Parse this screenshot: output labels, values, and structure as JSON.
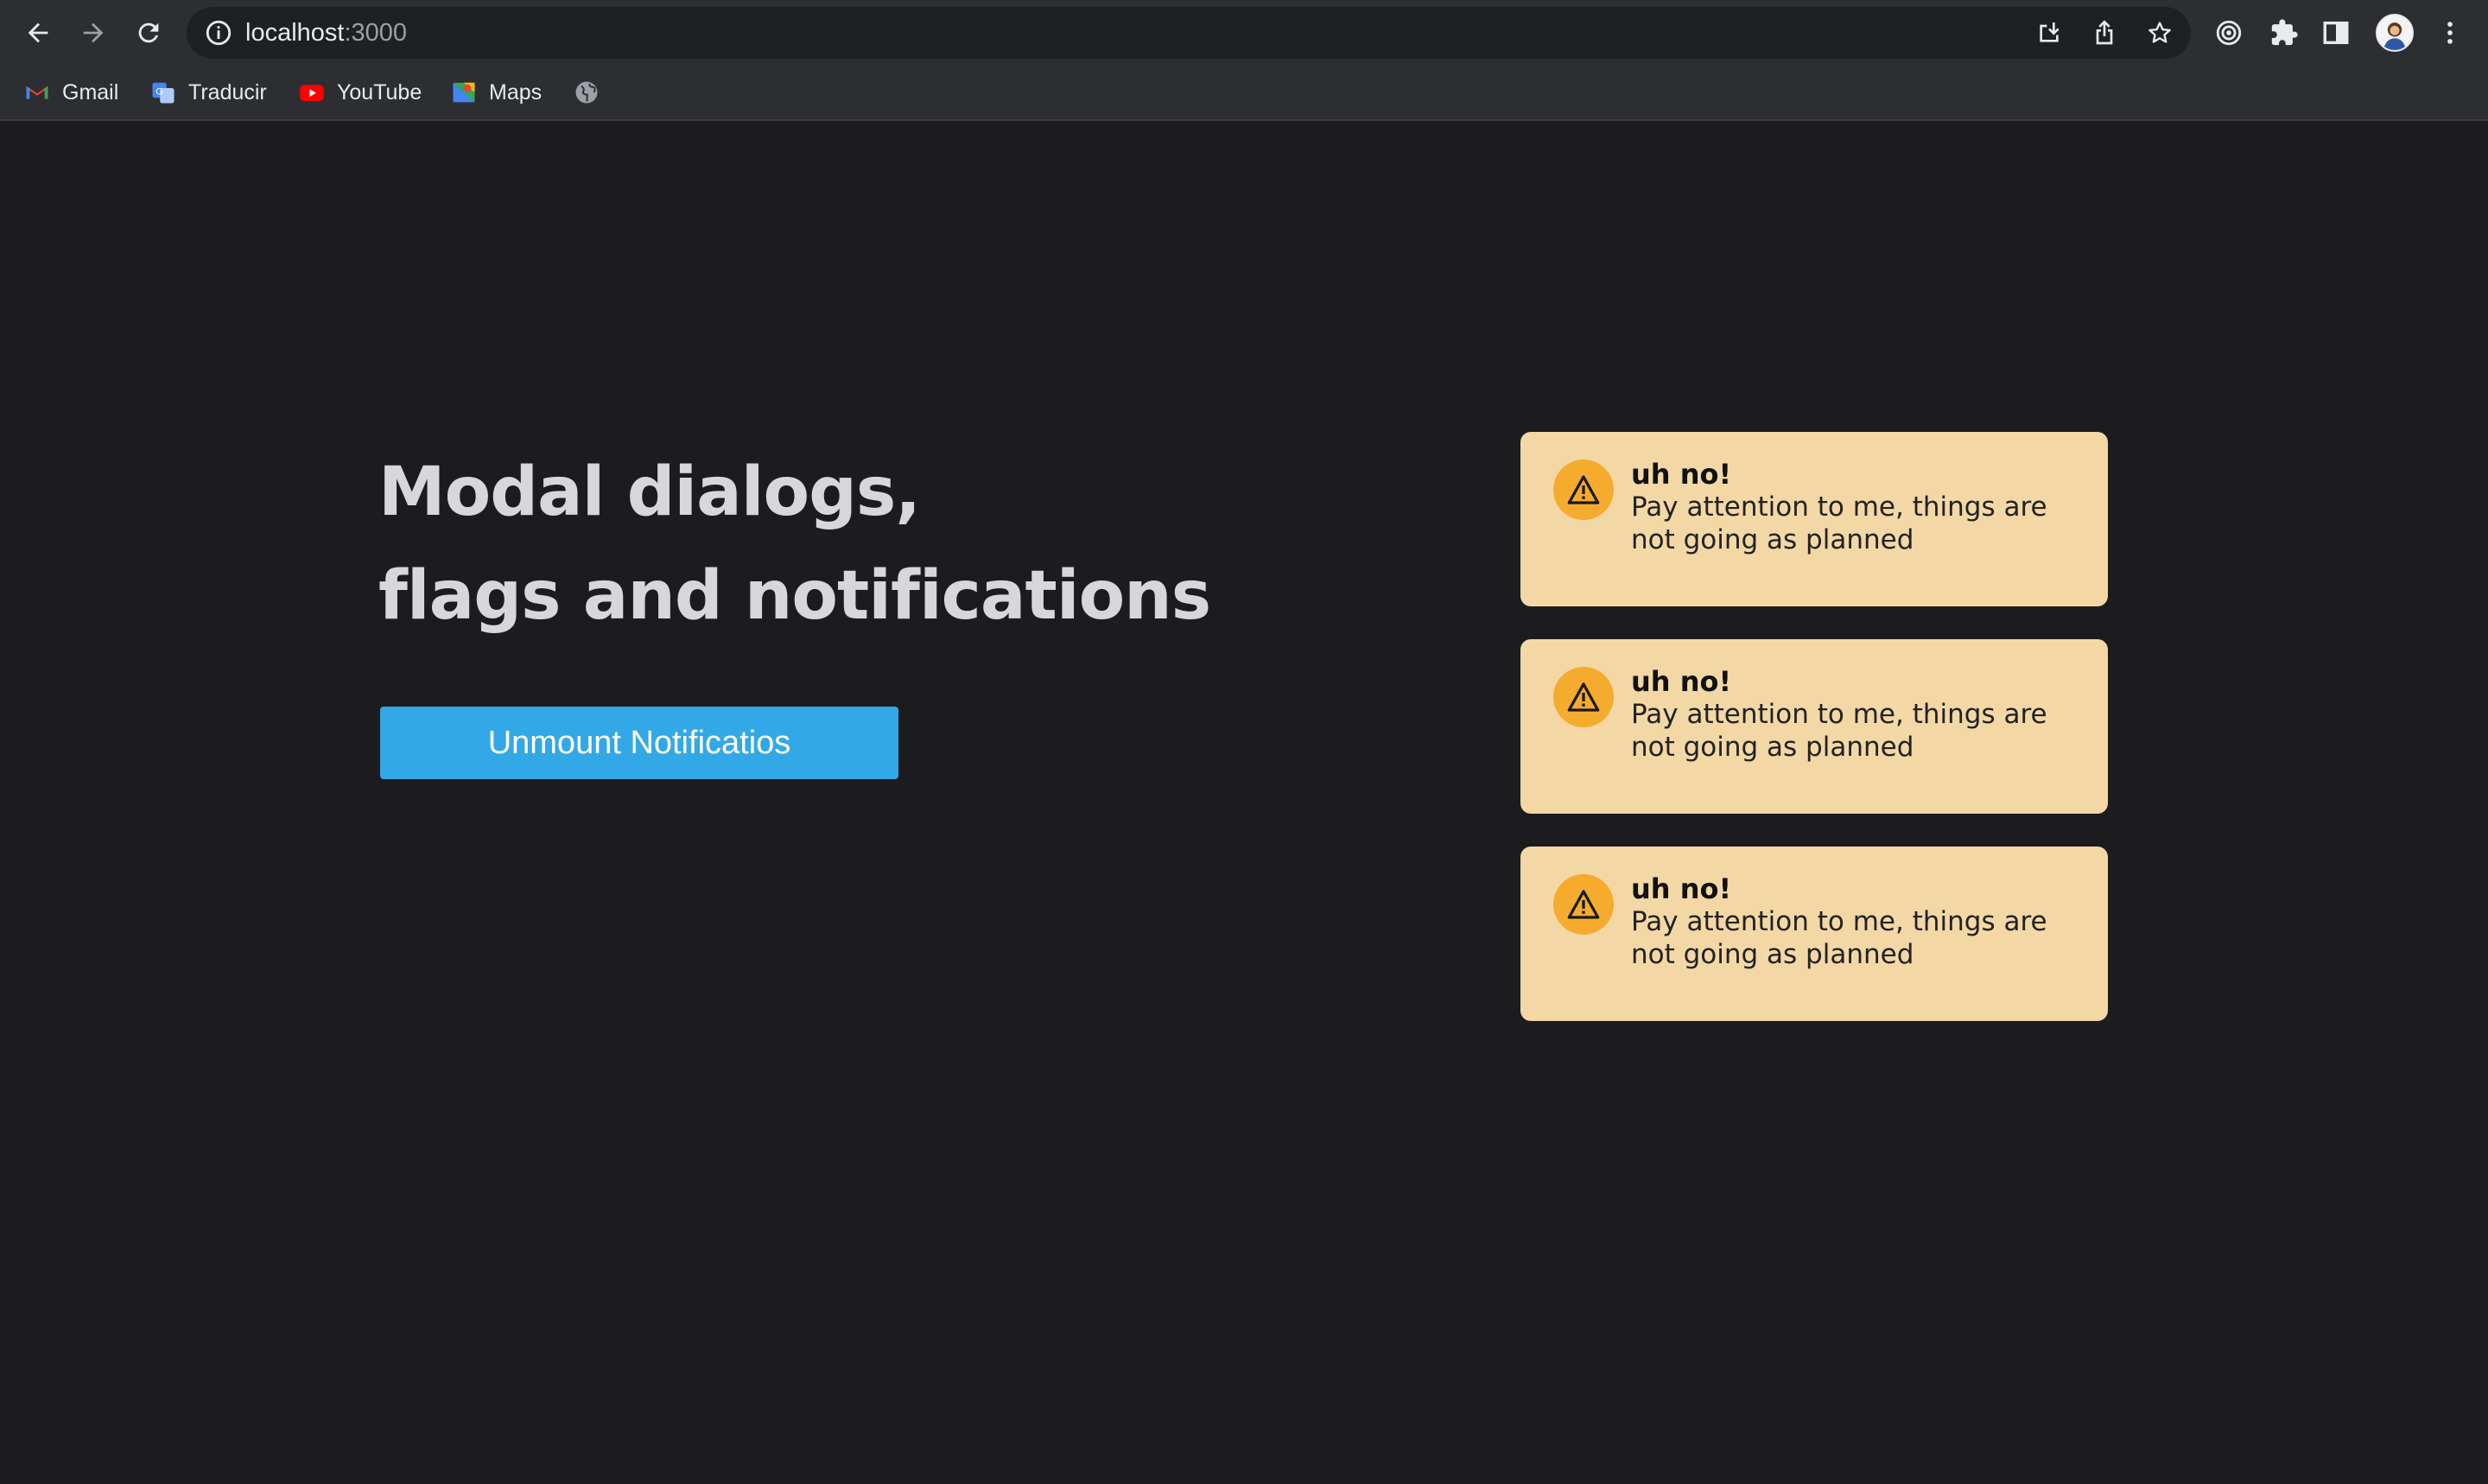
{
  "browser": {
    "url_host": "localhost",
    "url_port": ":3000",
    "bookmarks": [
      {
        "label": "Gmail",
        "icon": "gmail-icon"
      },
      {
        "label": "Traducir",
        "icon": "translate-icon"
      },
      {
        "label": "YouTube",
        "icon": "youtube-icon"
      },
      {
        "label": "Maps",
        "icon": "maps-icon"
      },
      {
        "label": "",
        "icon": "globe-icon"
      }
    ]
  },
  "page": {
    "headline_line1": "Modal dialogs,",
    "headline_line2": "flags and notifications",
    "unmount_button": "Unmount Notificatios"
  },
  "notifications": [
    {
      "title": "uh no!",
      "body": "Pay attention to me, things are not going as planned",
      "icon": "warning-icon"
    },
    {
      "title": "uh no!",
      "body": "Pay attention to me, things are not going as planned",
      "icon": "warning-icon"
    },
    {
      "title": "uh no!",
      "body": "Pay attention to me, things are not going as planned",
      "icon": "warning-icon"
    }
  ],
  "colors": {
    "background": "#1c1b1e",
    "button": "#33a8e6",
    "flag_background": "#f3d8a6",
    "flag_icon": "#f5ac2e"
  }
}
